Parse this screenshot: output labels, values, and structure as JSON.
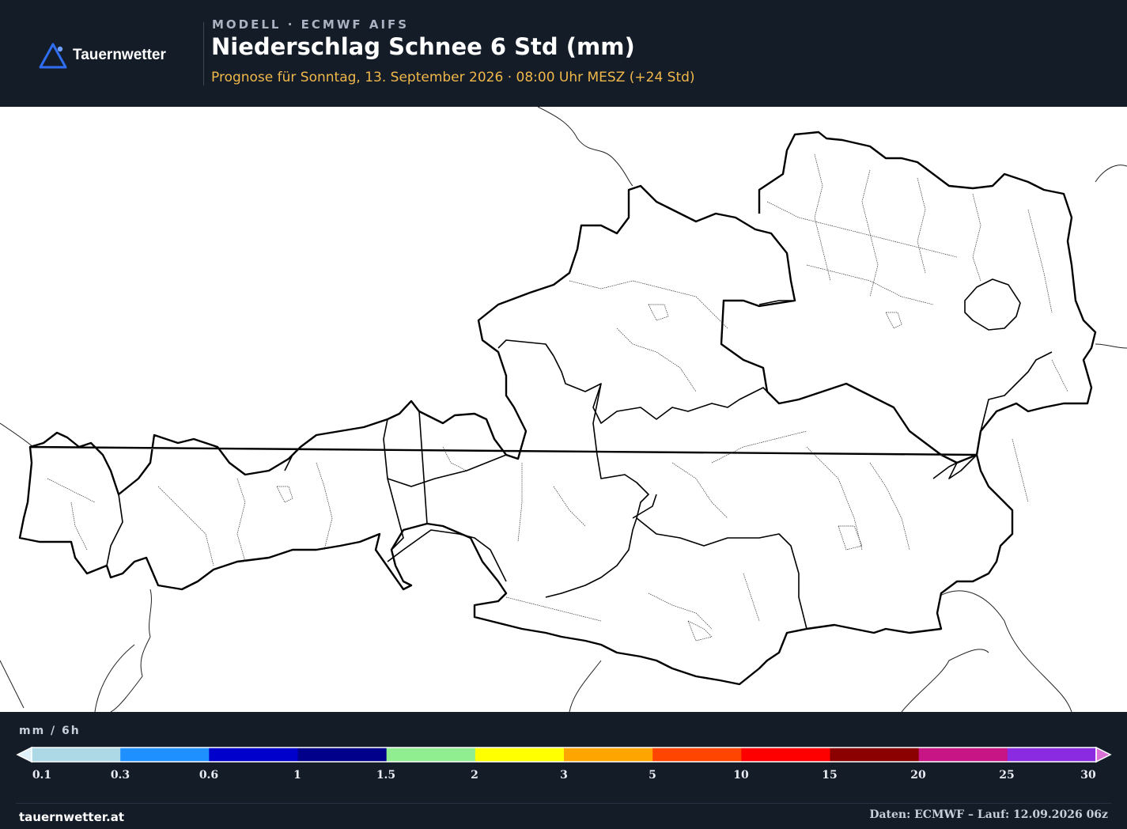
{
  "brand": {
    "name": "Tauernwetter",
    "logo_icon": "mountain-triangle-icon",
    "accent": "#2f6ef2"
  },
  "header": {
    "model_label": "MODELL · ECMWF AIFS",
    "title": "Niederschlag Schnee 6 Std (mm)",
    "subtitle": "Prognose für Sonntag, 13. September 2026 · 08:00 Uhr MESZ  (+24 Std)"
  },
  "legend": {
    "unit": "mm / 6h",
    "ticks": [
      "0.1",
      "0.3",
      "0.6",
      "1",
      "1.5",
      "2",
      "3",
      "5",
      "10",
      "15",
      "20",
      "25",
      "30"
    ],
    "colors": [
      "#add8e6",
      "#1e90ff",
      "#0000cd",
      "#00008b",
      "#90ee90",
      "#ffff00",
      "#ffa500",
      "#ff4500",
      "#ff0000",
      "#8b0000",
      "#c71585",
      "#8a2be2"
    ],
    "under_color": "#e0f0f8",
    "over_color": "#da70d6"
  },
  "footer": {
    "site": "tauernwetter.at",
    "run": "Daten: ECMWF – Lauf: 12.09.2026 06z"
  }
}
